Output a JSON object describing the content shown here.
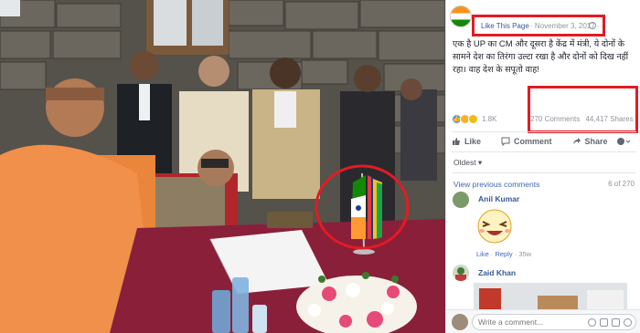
{
  "post": {
    "like_page": "Like This Page",
    "date": "· November 3, 2017 ·",
    "text": "एक है UP का CM और दूसरा है केंद्र में मंत्री, ये दोनों के सामने देश का तिरंगा उल्टा रखा है और दोनों को दिख नहीं रहा। वाह देश के सपूतो वाह!",
    "reaction_count": "1.8K",
    "comments_count": "270 Comments",
    "shares_count": "44,417 Shares"
  },
  "actions": {
    "like": "Like",
    "comment": "Comment",
    "share": "Share"
  },
  "comments_section": {
    "sort_label": "Oldest ▾",
    "view_previous": "View previous comments",
    "of_count": "6 of 270"
  },
  "comments": [
    {
      "name": "Anil Kumar",
      "like": "Like",
      "reply": "Reply",
      "time": "35w"
    },
    {
      "name": "Zaid Khan"
    }
  ],
  "composer": {
    "placeholder": "Write a comment..."
  },
  "colors": {
    "highlight_red": "#e31b23",
    "facebook_link": "#365899",
    "facebook_blue": "#4267b2"
  }
}
